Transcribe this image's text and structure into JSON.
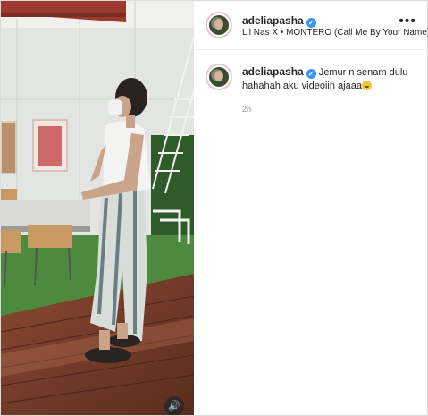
{
  "post": {
    "username": "adeliapasha",
    "music": "Lil Nas X • MONTERO (Call Me By Your Name)",
    "more_label": "•••",
    "caption_line1": "Jemur n senam dulu",
    "caption_line2": "hahahah aku videoiin ajaaa",
    "time": "2h"
  },
  "icons": {
    "verified": "verified-badge-icon",
    "more": "more-options-icon",
    "sound": "speaker-icon",
    "emoji": "grinning-face-icon"
  },
  "colors": {
    "verified": "#3897f0",
    "text": "#262626",
    "muted": "#8e8e8e"
  }
}
